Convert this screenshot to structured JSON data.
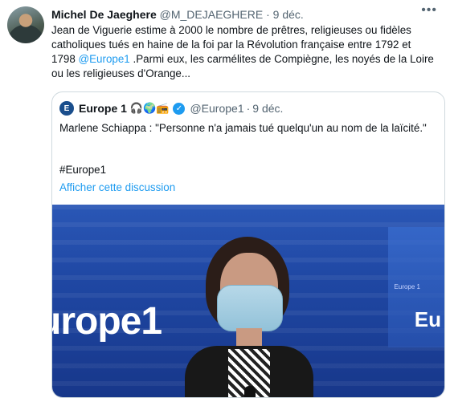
{
  "tweet": {
    "author_name": "Michel De Jaeghere",
    "author_handle": "@M_DEJAEGHERE",
    "separator": "·",
    "date": "9 déc.",
    "more": "•••",
    "text_part1": "Jean de Viguerie estime à 2000 le nombre de prêtres, religieuses ou fidèles catholiques tués en haine de la foi par la Révolution française entre 1792 et 1798 ",
    "mention": "@Europe1",
    "text_part2": " .Parmi eux, les carmélites de Compiègne,  les noyés de la Loire ou les religieuses d'Orange..."
  },
  "quoted": {
    "avatar_text": "E",
    "author_name": "Europe 1",
    "emojis": "🎧🌍📻",
    "verified_mark": "✓",
    "author_handle": "@Europe1",
    "separator": "·",
    "date": "9 déc.",
    "text": "Marlene Schiappa : \"Personne n'a jamais tué quelqu'un au nom de la laïcité.\"",
    "hashtag": "#Europe1",
    "show_thread": "Afficher cette discussion",
    "media": {
      "brand_big": "urope1",
      "brand_small": "Eu",
      "brand_tiny": "Europe 1"
    }
  },
  "colors": {
    "link": "#1d9bf0",
    "verified": "#1d9bf0",
    "muted": "#536471"
  }
}
